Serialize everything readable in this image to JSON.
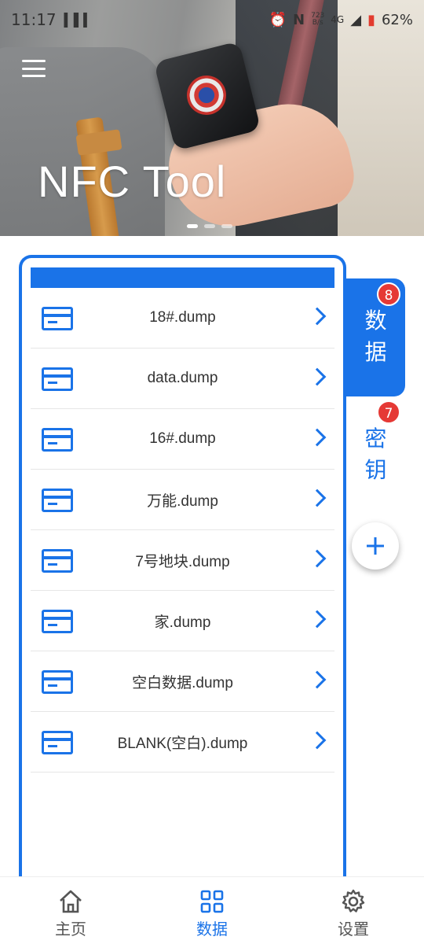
{
  "status_bar": {
    "time": "11:17",
    "speed": "723",
    "speed_unit": "B/s",
    "network": "4G",
    "battery": "62%"
  },
  "banner": {
    "title": "NFC Tool",
    "page_indicator": {
      "count": 3,
      "active_index": 0
    }
  },
  "side_tabs": {
    "data": {
      "label": "数据",
      "badge": "8",
      "active": true
    },
    "keys": {
      "label": "密钥",
      "badge": "7",
      "active": false
    }
  },
  "files": [
    {
      "name": "18#.dump"
    },
    {
      "name": "data.dump"
    },
    {
      "name": "16#.dump"
    },
    {
      "name": "万能.dump"
    },
    {
      "name": "7号地块.dump"
    },
    {
      "name": "家.dump"
    },
    {
      "name": "空白数据.dump"
    },
    {
      "name": "BLANK(空白).dump"
    }
  ],
  "bottom_nav": {
    "items": [
      {
        "label": "主页",
        "icon": "home-icon",
        "active": false
      },
      {
        "label": "数据",
        "icon": "grid-icon",
        "active": true
      },
      {
        "label": "设置",
        "icon": "gear-icon",
        "active": false
      }
    ]
  },
  "colors": {
    "accent": "#1a73e8",
    "badge": "#e53935",
    "text": "#333333"
  }
}
